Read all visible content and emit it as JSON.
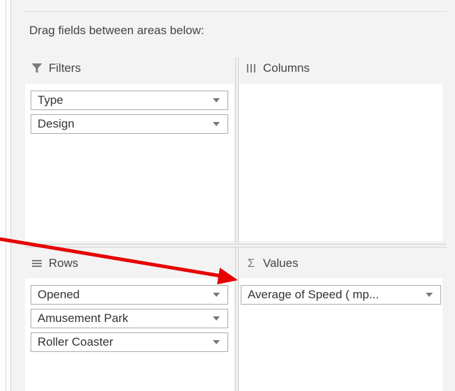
{
  "instructions": "Drag fields between areas below:",
  "areas": {
    "filters": {
      "label": "Filters",
      "icon": "filter-icon",
      "fields": [
        {
          "label": "Type"
        },
        {
          "label": "Design"
        }
      ]
    },
    "columns": {
      "label": "Columns",
      "icon": "columns-icon",
      "fields": []
    },
    "rows": {
      "label": "Rows",
      "icon": "rows-icon",
      "fields": [
        {
          "label": "Opened"
        },
        {
          "label": "Amusement Park"
        },
        {
          "label": "Roller Coaster"
        }
      ]
    },
    "values": {
      "label": "Values",
      "icon": "sigma-icon",
      "fields": [
        {
          "label": "Average of Speed ( mp..."
        }
      ]
    }
  },
  "annotation": {
    "arrow_color": "#e60000"
  }
}
